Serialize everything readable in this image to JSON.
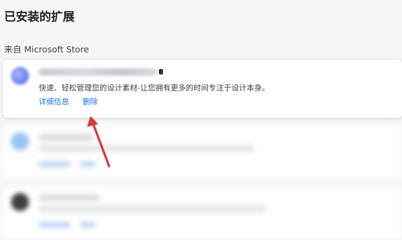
{
  "page": {
    "title": "已安装的扩展"
  },
  "section": {
    "label": "来自 Microsoft Store"
  },
  "extensions": [
    {
      "description": "快速、轻松管理您的设计素材-让您拥有更多的时间专注于设计本身。",
      "details_label": "详细信息",
      "remove_label": "删除"
    }
  ],
  "colors": {
    "link": "#1a73e8",
    "annotation_arrow": "#e0353b",
    "card_background": "#ffffff",
    "page_background": "#f5f6f7"
  },
  "icons": [
    "extension-icon",
    "arrow-annotation"
  ]
}
